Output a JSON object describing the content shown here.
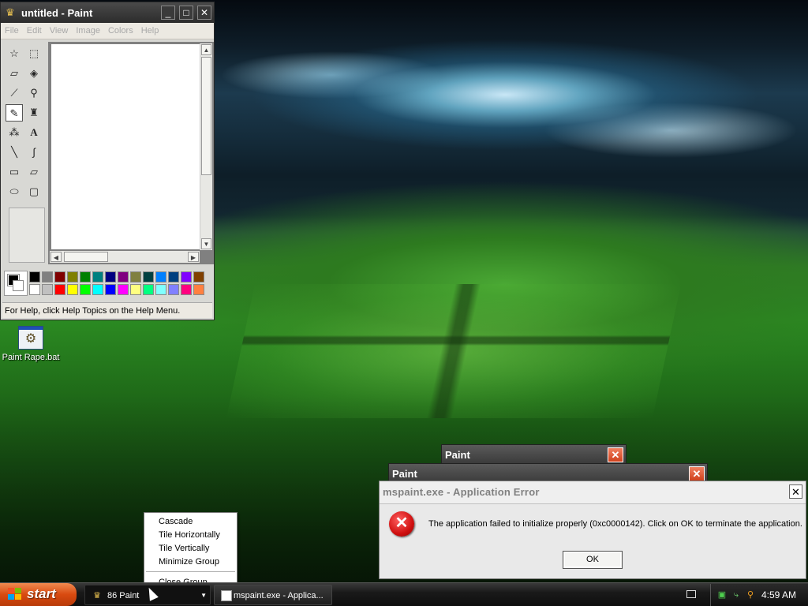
{
  "paint": {
    "title": "untitled - Paint",
    "menu": [
      "File",
      "Edit",
      "View",
      "Image",
      "Colors",
      "Help"
    ],
    "status": "For Help, click Help Topics on the Help Menu.",
    "palette_top": [
      "#000000",
      "#808080",
      "#800000",
      "#808000",
      "#008000",
      "#008080",
      "#000080",
      "#800080",
      "#808040",
      "#004040",
      "#0080ff",
      "#004080",
      "#8000ff",
      "#804000"
    ],
    "palette_bottom": [
      "#ffffff",
      "#c0c0c0",
      "#ff0000",
      "#ffff00",
      "#00ff00",
      "#00ffff",
      "#0000ff",
      "#ff00ff",
      "#ffff80",
      "#00ff80",
      "#80ffff",
      "#8080ff",
      "#ff0080",
      "#ff8040"
    ],
    "tools": [
      "free-select-icon",
      "rect-select-icon",
      "eraser-icon",
      "fill-icon",
      "color-picker-icon",
      "magnifier-icon",
      "pencil-icon",
      "brush-icon",
      "airbrush-icon",
      "text-icon",
      "line-icon",
      "curve-icon",
      "rectangle-icon",
      "polygon-icon",
      "ellipse-icon",
      "rounded-rect-icon"
    ]
  },
  "desktop_icon": {
    "label": "Paint Rape.bat"
  },
  "bg_dialog_1": {
    "title": "Paint"
  },
  "bg_dialog_2": {
    "title": "Paint"
  },
  "error_dialog": {
    "title": "mspaint.exe - Application Error",
    "message": "The application failed to initialize properly (0xc0000142). Click on OK to terminate the application.",
    "ok_label": "OK"
  },
  "context_menu": {
    "items": [
      "Cascade",
      "Tile Horizontally",
      "Tile Vertically",
      "Minimize Group",
      "Close Group"
    ]
  },
  "taskbar": {
    "start_label": "start",
    "tasks": [
      {
        "label": "86 Paint"
      },
      {
        "label": "mspaint.exe - Applica..."
      }
    ],
    "clock": "4:59 AM"
  }
}
